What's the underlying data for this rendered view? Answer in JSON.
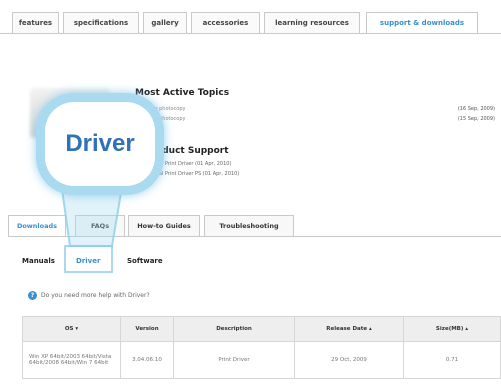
{
  "topnav": {
    "tabs": [
      {
        "label": "features"
      },
      {
        "label": "specifications"
      },
      {
        "label": "gallery"
      },
      {
        "label": "accessories"
      },
      {
        "label": "learning resources"
      },
      {
        "label": "support & downloads",
        "active": true
      }
    ]
  },
  "most_active": {
    "title": "Most Active Topics",
    "items": [
      {
        "label": "How to photocopy",
        "date": "(16 Sep, 2009)"
      },
      {
        "label": "How to photocopy",
        "date": "(15 Sep, 2009)"
      }
    ]
  },
  "product_support": {
    "title": "Product Support",
    "items": [
      "Universal Print Driver (01 Apr, 2010)",
      "Universal Print Driver PS (01 Apr, 2010)"
    ]
  },
  "subtabs": [
    {
      "label": "Downloads",
      "active": true
    },
    {
      "label": "FAQs"
    },
    {
      "label": "How-to Guides"
    },
    {
      "label": "Troubleshooting"
    }
  ],
  "categories": [
    {
      "label": "Manuals"
    },
    {
      "label": "Driver",
      "active": true
    },
    {
      "label": "Software"
    }
  ],
  "help": {
    "text": "Do you need more help with Driver?",
    "icon": "question-icon"
  },
  "table": {
    "headers": [
      "OS ▾",
      "Version",
      "Description",
      "Release Date ▴",
      "Size(MB) ▴"
    ],
    "rows": [
      {
        "os": "Win XP 64bit/2003 64bit/Vista 64bit/2008 64bit/Win 7 64bit",
        "version": "3.04.06:10",
        "description": "Print Driver",
        "release_date": "29 Oct, 2009",
        "size": "0.71"
      }
    ]
  },
  "zoom_callout": {
    "label": "Driver"
  },
  "colors": {
    "accent": "#3a8fd0",
    "callout": "#8ccdeb"
  }
}
